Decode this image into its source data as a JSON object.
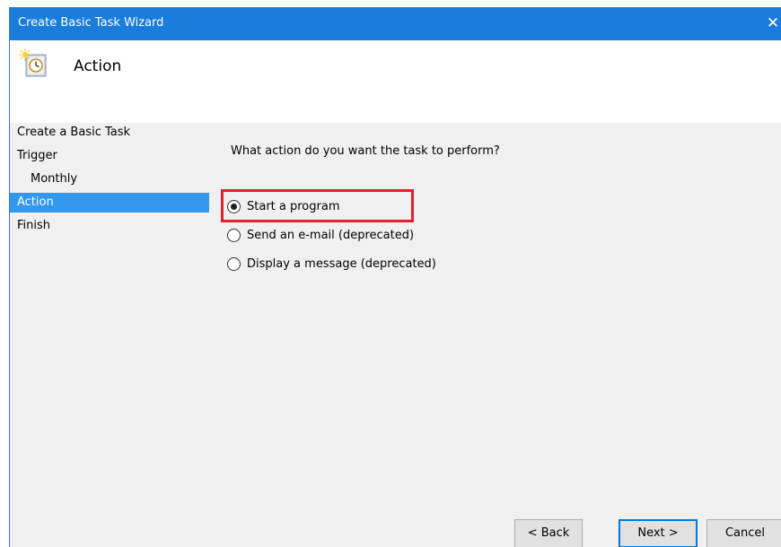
{
  "window": {
    "title": "Create Basic Task Wizard",
    "close_glyph": "✕"
  },
  "header": {
    "icon": "task-scheduler-icon",
    "title": "Action"
  },
  "steps": [
    {
      "label": "Create a Basic Task",
      "level": 0,
      "selected": false
    },
    {
      "label": "Trigger",
      "level": 0,
      "selected": false
    },
    {
      "label": "Monthly",
      "level": 1,
      "selected": false
    },
    {
      "label": "Action",
      "level": 0,
      "selected": true
    },
    {
      "label": "Finish",
      "level": 0,
      "selected": false
    }
  ],
  "content": {
    "question": "What action do you want the task to perform?",
    "options": [
      {
        "label": "Start a program",
        "mnemonic": "S",
        "checked": true
      },
      {
        "label": "Send an e-mail (deprecated)",
        "mnemonic": "S",
        "checked": false
      },
      {
        "label": "Display a message (deprecated)",
        "mnemonic": "m",
        "checked": false
      }
    ],
    "highlight_color": "#e0202a"
  },
  "buttons": {
    "back_label": "< Back",
    "next_label": "Next >",
    "cancel_label": "Cancel"
  },
  "colors": {
    "titlebar": "#1a7ddb",
    "selected_step": "#3397ee"
  }
}
